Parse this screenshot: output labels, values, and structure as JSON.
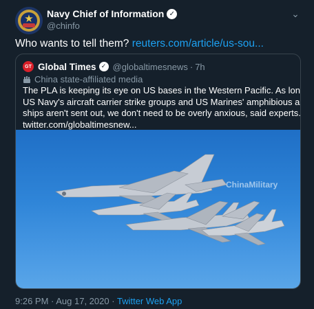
{
  "author": {
    "display_name": "Navy Chief of Information",
    "handle": "@chinfo",
    "avatar_icon": "navy-seal-icon",
    "verified_icon": "verified-badge-icon"
  },
  "menu_icon": "chevron-down-icon",
  "tweet": {
    "text": "Who wants to tell them?",
    "link": "reuters.com/article/us-sou..."
  },
  "quoted": {
    "avatar_label": "GT",
    "display_name": "Global Times",
    "handle": "@globaltimesnews",
    "separator": "·",
    "time": "7h",
    "label": "China state-affiliated media",
    "label_icon": "flag-icon",
    "body_lines": [
      "The PLA is keeping its eye on US bases in the Western Pacific. As long as the",
      "US Navy's aircraft carrier strike groups and US Marines' amphibious assault",
      "ships aren't sent out, we don't need to be overly anxious, said experts.",
      "twitter.com/globaltimesnew..."
    ],
    "image": {
      "description_icon": "military-aircraft-photo",
      "watermark": "ChinaMilitary"
    }
  },
  "footer": {
    "timestamp": "9:26 PM · Aug 17, 2020",
    "separator": "·",
    "source": "Twitter Web App"
  },
  "colors": {
    "background": "#15202b",
    "link": "#1da1f2",
    "secondary_text": "#8899a6",
    "border": "#38444d"
  }
}
